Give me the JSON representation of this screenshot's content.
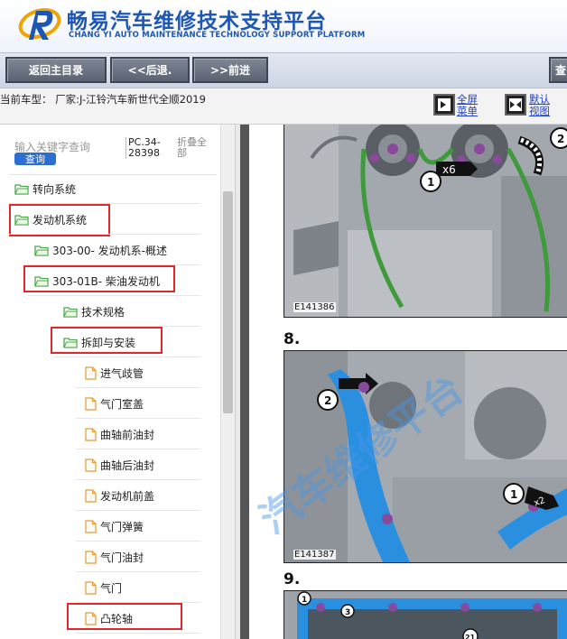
{
  "header": {
    "title_cn": "畅易汽车维修技术支持平台",
    "title_en": "CHANG YI AUTO MAINTENANCE TECHNOLOGY SUPPORT PLATFORM"
  },
  "nav": {
    "home_label": "返回主目录",
    "back_label": "<<后退.",
    "forward_label": ">>前进",
    "query_label": "查"
  },
  "info": {
    "current_model": "当前车型： 厂家:J-江铃汽车新世代全顺2019",
    "fullscreen_label": "全屏菜单",
    "default_view_label": "默认视图"
  },
  "search": {
    "placeholder": "输入关键字查询",
    "query_button": "查询",
    "pc_code": "PC.34-28398",
    "collapse_all": "折叠全部"
  },
  "tree": [
    {
      "label": "转向系统",
      "icon": "folder-open-icon"
    },
    {
      "label": "发动机系统",
      "icon": "folder-open-icon"
    },
    {
      "label": "303-00- 发动机系-概述",
      "icon": "folder-open-icon"
    },
    {
      "label": "303-01B- 柴油发动机",
      "icon": "folder-open-icon"
    },
    {
      "label": "技术规格",
      "icon": "folder-open-icon"
    },
    {
      "label": "拆卸与安装",
      "icon": "folder-open-icon"
    },
    {
      "label": "进气歧管",
      "icon": "document-icon"
    },
    {
      "label": "气门室盖",
      "icon": "document-icon"
    },
    {
      "label": "曲轴前油封",
      "icon": "document-icon"
    },
    {
      "label": "曲轴后油封",
      "icon": "document-icon"
    },
    {
      "label": "发动机前盖",
      "icon": "document-icon"
    },
    {
      "label": "气门弹簧",
      "icon": "document-icon"
    },
    {
      "label": "气门油封",
      "icon": "document-icon"
    },
    {
      "label": "气门",
      "icon": "document-icon"
    },
    {
      "label": "凸轮轴",
      "icon": "document-icon"
    }
  ],
  "document": {
    "figures": [
      {
        "id": "E141386",
        "callouts": [
          "1",
          "2"
        ],
        "multiplier": "x6"
      },
      {
        "step": "8.",
        "id": "E141387",
        "callouts": [
          "1",
          "2"
        ],
        "multiplier": "x2"
      },
      {
        "step": "9.",
        "callouts": [
          "1",
          "3",
          "21"
        ]
      }
    ],
    "watermark": "汽车维修平台"
  },
  "colors": {
    "brand_blue": "#1e56b4",
    "highlight_red": "#e0282c",
    "nav_button": "#5b6271",
    "folder_green": "#4aa84a",
    "document_orange": "#e39a3c",
    "timing_belt_green": "#3e9a3a",
    "timing_guide_blue": "#2b8fe0"
  }
}
